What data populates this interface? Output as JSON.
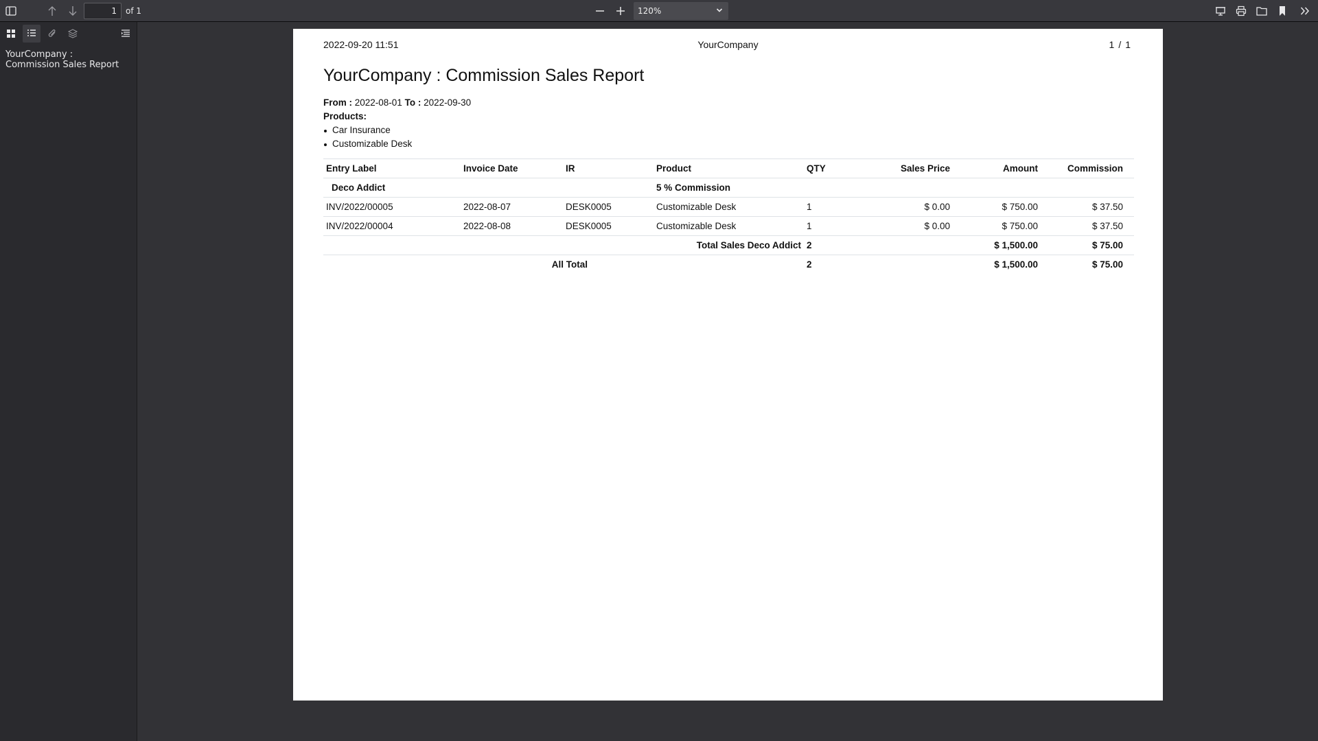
{
  "toolbar": {
    "page_number": "1",
    "page_count": "of 1",
    "zoom": "120%"
  },
  "sidebar": {
    "outline": [
      "YourCompany : Commission Sales Report"
    ]
  },
  "report": {
    "header_date": "2022-09-20 11:51",
    "header_company": "YourCompany",
    "page_current": "1",
    "page_sep": "/",
    "page_total": "1",
    "title": "YourCompany : Commission Sales Report",
    "from_label": "From :",
    "from_date": "2022-08-01",
    "to_label": "To :",
    "to_date": "2022-09-30",
    "products_label": "Products:",
    "products": [
      "Car Insurance",
      "Customizable Desk"
    ],
    "columns": [
      "Entry Label",
      "Invoice Date",
      "IR",
      "Product",
      "QTY",
      "Sales Price",
      "Amount",
      "Commission"
    ],
    "group": {
      "name": "Deco Addict",
      "commission_rule": "5 % Commission"
    },
    "rows": [
      [
        "INV/2022/00005",
        "2022-08-07",
        "DESK0005",
        "Customizable Desk",
        "1",
        "$ 0.00",
        "$ 750.00",
        "$ 37.50"
      ],
      [
        "INV/2022/00004",
        "2022-08-08",
        "DESK0005",
        "Customizable Desk",
        "1",
        "$ 0.00",
        "$ 750.00",
        "$ 37.50"
      ]
    ],
    "subtotal": {
      "label": "Total Sales Deco Addict",
      "qty": "2",
      "amount": "$ 1,500.00",
      "commission": "$ 75.00"
    },
    "grand_total": {
      "label": "All Total",
      "qty": "2",
      "amount": "$ 1,500.00",
      "commission": "$ 75.00"
    }
  }
}
